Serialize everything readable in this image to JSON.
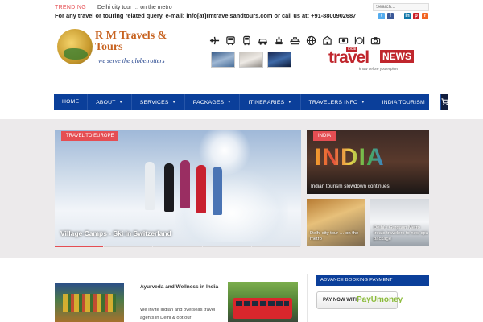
{
  "topbar": {
    "trending_label": "TRENDING",
    "trending_text": "Delhi city tour … on the metro",
    "contact_text": "For any travel or touring related query, e-mail: info[at]rmtravelsandtours.com or call us at: +91-8800902687",
    "search_placeholder": "Search...",
    "social": [
      {
        "name": "twitter-icon",
        "glyph": "t",
        "color": "#55acee"
      },
      {
        "name": "facebook-icon",
        "glyph": "f",
        "color": "#3b5998"
      },
      {
        "name": "linkedin-icon",
        "glyph": "in",
        "color": "#0e76a8"
      },
      {
        "name": "pinterest-icon",
        "glyph": "p",
        "color": "#cb2027"
      },
      {
        "name": "rss-icon",
        "glyph": "r",
        "color": "#f26522"
      }
    ]
  },
  "header": {
    "logo_name": "R M Travels & Tours",
    "logo_tagline": "we serve the globetrotters",
    "travelnews": {
      "travel": "travel",
      "local": "local",
      "news": "NEWS",
      "tagline": "know before you explore"
    }
  },
  "nav": {
    "items": [
      {
        "label": "HOME",
        "dropdown": false
      },
      {
        "label": "ABOUT",
        "dropdown": true
      },
      {
        "label": "SERVICES",
        "dropdown": true
      },
      {
        "label": "PACKAGES",
        "dropdown": true
      },
      {
        "label": "ITINERARIES",
        "dropdown": true
      },
      {
        "label": "TRAVELERS INFO",
        "dropdown": true
      },
      {
        "label": "INDIA TOURISM",
        "dropdown": true
      }
    ],
    "cart_icon": "cart-icon"
  },
  "featured": {
    "main": {
      "category": "TRAVEL TO EUROPE",
      "title": "Village Camps - Ski in Switzerland"
    },
    "india": {
      "category": "INDIA",
      "title": "Indian tourism slowdown continues",
      "art_text": "INDIA"
    },
    "delhi": {
      "title": "Delhi city tour … on the metro"
    },
    "spa": {
      "title": "Delhi's Gurgaon Metro treats travelers to new spa package"
    }
  },
  "content": {
    "ayurveda_title": "Ayurveda and Wellness in India",
    "ayurveda_text": "We invite Indian and overseas travel agents in Delhi & opt our"
  },
  "sidebar": {
    "booking_heading": "ADVANCE BOOKING PAYMENT",
    "pay_label": "PAY NOW WITH",
    "pay_brand": "PayUmoney"
  }
}
